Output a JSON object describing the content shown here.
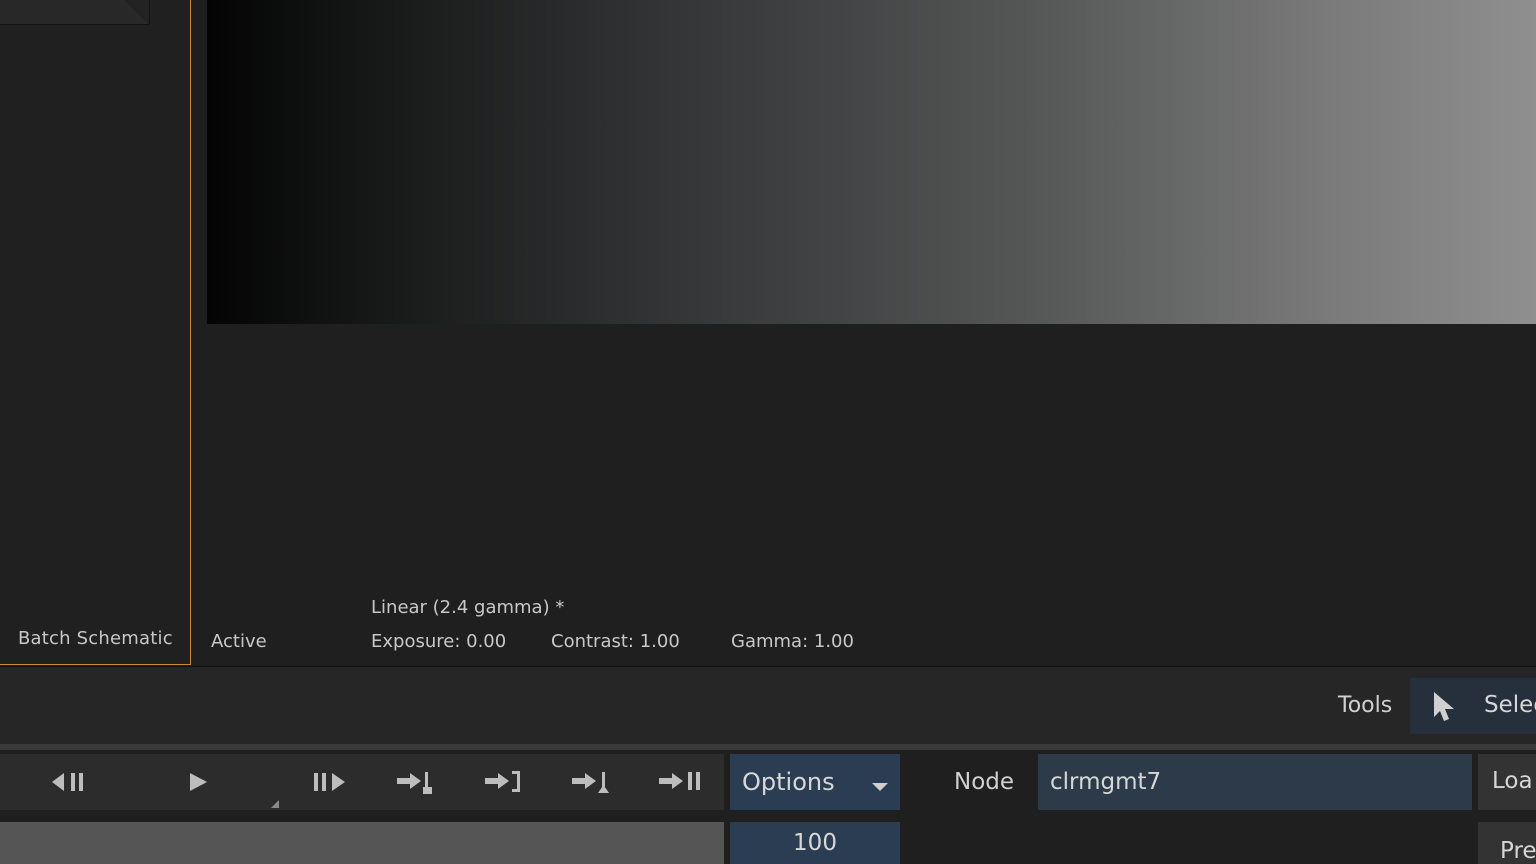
{
  "schematic": {
    "label": "Batch Schematic"
  },
  "viewer": {
    "mode": "Active",
    "colorspace": "Linear (2.4 gamma) *",
    "exposure": "Exposure: 0.00",
    "contrast": "Contrast: 1.00",
    "gamma": "Gamma: 1.00"
  },
  "tools": {
    "label": "Tools",
    "select_label": "Selec"
  },
  "transport": {
    "buttons": [
      "step-back-icon",
      "play-icon",
      "step-forward-icon",
      "goto-in-icon",
      "goto-out-bracket-icon",
      "goto-mark-icon",
      "goto-end-icon"
    ],
    "options_label": "Options",
    "frame_value": "100"
  },
  "node": {
    "label": "Node",
    "value": "clrmgmt7"
  },
  "right": {
    "load_label": "Loa",
    "preset_label": "Pre"
  },
  "colors": {
    "accent": "#c78a2e",
    "field_blue": "#2a3d53"
  }
}
